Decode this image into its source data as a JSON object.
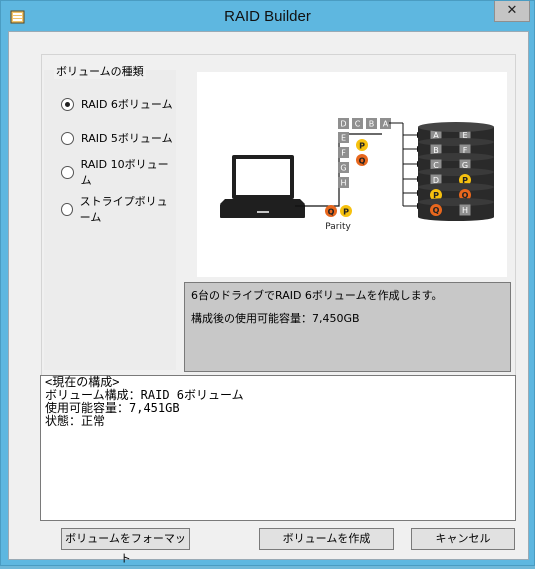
{
  "window": {
    "title": "RAID Builder",
    "close_glyph": "✕"
  },
  "volume_type": {
    "legend": "ボリュームの種類",
    "options": [
      {
        "label": "RAID 6ボリューム",
        "checked": true
      },
      {
        "label": "RAID 5ボリューム",
        "checked": false
      },
      {
        "label": "RAID 10ボリューム",
        "checked": false
      },
      {
        "label": "ストライプボリューム",
        "checked": false
      }
    ]
  },
  "diagram": {
    "data_blocks": [
      "D",
      "C",
      "B",
      "A"
    ],
    "column_blocks": [
      "E",
      "F",
      "G",
      "H"
    ],
    "parity_q": "Q",
    "parity_p": "P",
    "parity_label": "Parity",
    "disk_rows": [
      [
        "A",
        "E"
      ],
      [
        "B",
        "F"
      ],
      [
        "C",
        "G"
      ],
      [
        "D",
        "P"
      ],
      [
        "P",
        "Q"
      ],
      [
        "Q",
        "H"
      ]
    ]
  },
  "description": {
    "line1": "6台のドライブでRAID 6ボリュームを作成します。",
    "line2": "構成後の使用可能容量：7,450GB"
  },
  "current_config": {
    "heading": "<現在の構成>",
    "line1": "ボリューム構成：RAID 6ボリューム",
    "line2": "使用可能容量：7,451GB",
    "line3": "状態：正常"
  },
  "buttons": {
    "format": "ボリュームをフォーマット",
    "create": "ボリュームを作成",
    "cancel": "キャンセル"
  },
  "colors": {
    "parity_p": "#f6c10f",
    "parity_q": "#e8671d",
    "block_gray": "#8f8f8f",
    "disk_dark": "#2a2a2a"
  }
}
